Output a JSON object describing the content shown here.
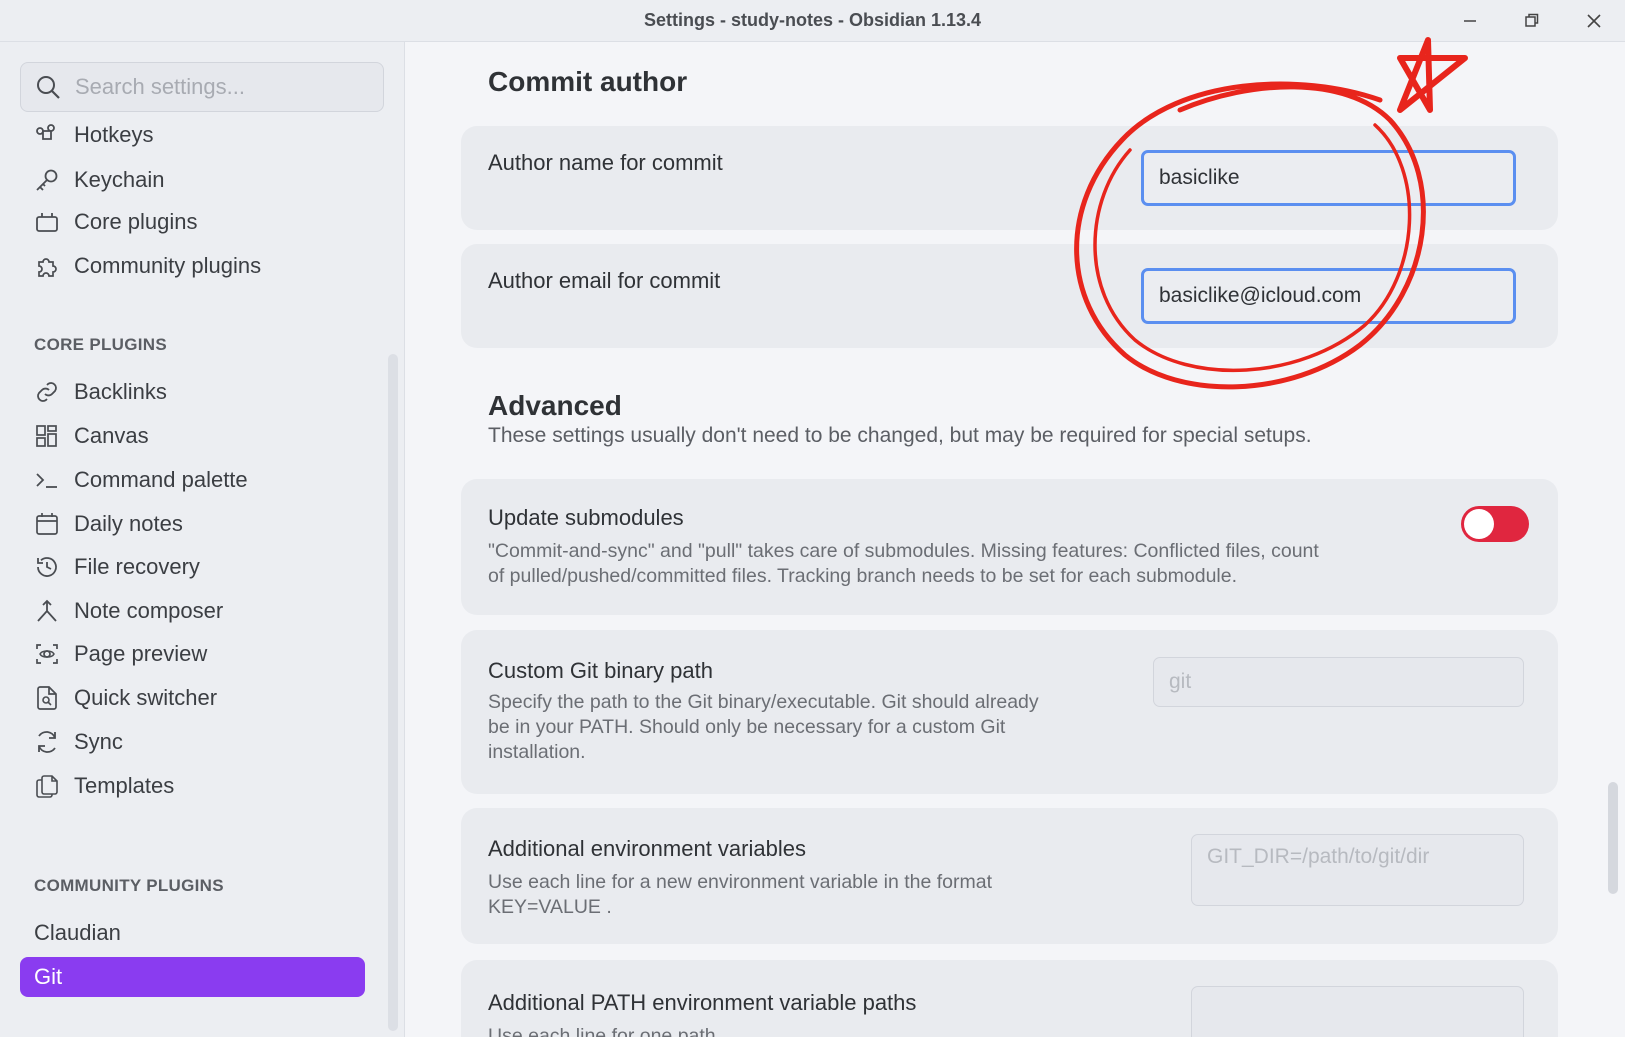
{
  "window": {
    "title": "Settings - study-notes - Obsidian 1.13.4"
  },
  "search": {
    "placeholder": "Search settings..."
  },
  "sidebar": {
    "options_items": [
      {
        "label": "Hotkeys",
        "icon": "command-key-icon"
      },
      {
        "label": "Keychain",
        "icon": "key-icon"
      },
      {
        "label": "Core plugins",
        "icon": "plug-icon"
      },
      {
        "label": "Community plugins",
        "icon": "puzzle-icon"
      }
    ],
    "core_section": "CORE PLUGINS",
    "core_items": [
      {
        "label": "Backlinks",
        "icon": "link-icon"
      },
      {
        "label": "Canvas",
        "icon": "canvas-grid-icon"
      },
      {
        "label": "Command palette",
        "icon": "terminal-prompt-icon"
      },
      {
        "label": "Daily notes",
        "icon": "calendar-icon"
      },
      {
        "label": "File recovery",
        "icon": "history-icon"
      },
      {
        "label": "Note composer",
        "icon": "merge-icon"
      },
      {
        "label": "Page preview",
        "icon": "scan-eye-icon"
      },
      {
        "label": "Quick switcher",
        "icon": "file-search-icon"
      },
      {
        "label": "Sync",
        "icon": "sync-icon"
      },
      {
        "label": "Templates",
        "icon": "files-icon"
      }
    ],
    "community_section": "COMMUNITY PLUGINS",
    "community_items": [
      {
        "label": "Claudian",
        "active": false
      },
      {
        "label": "Git",
        "active": true
      }
    ]
  },
  "main": {
    "commit_author_heading": "Commit author",
    "author_name": {
      "label": "Author name for commit",
      "value": "basiclike"
    },
    "author_email": {
      "label": "Author email for commit",
      "value": "basiclike@icloud.com"
    },
    "advanced_heading": "Advanced",
    "advanced_desc": "These settings usually don't need to be changed, but may be required for special setups.",
    "update_submodules": {
      "label": "Update submodules",
      "desc_line1": "\"Commit-and-sync\" and \"pull\" takes care of submodules. Missing features: Conflicted files, count",
      "desc_line2": "of pulled/pushed/committed files. Tracking branch needs to be set for each submodule.",
      "enabled": false
    },
    "git_binary": {
      "label": "Custom Git binary path",
      "desc_line1": "Specify the path to the Git binary/executable. Git should already",
      "desc_line2": "be in your PATH. Should only be necessary for a custom Git",
      "desc_line3": "installation.",
      "placeholder": "git"
    },
    "env_vars": {
      "label": "Additional environment variables",
      "desc_line1": "Use each line for a new environment variable in the format",
      "desc_line2": "KEY=VALUE .",
      "placeholder": "GIT_DIR=/path/to/git/dir"
    },
    "path_vars": {
      "label": "Additional PATH environment variable paths",
      "desc_line1": "Use each line for one path"
    }
  },
  "colors": {
    "accent": "#8a3cf0",
    "toggle_off": "#e0263f",
    "focus_border": "#5b8ff0",
    "annotation": "#e8251c"
  }
}
